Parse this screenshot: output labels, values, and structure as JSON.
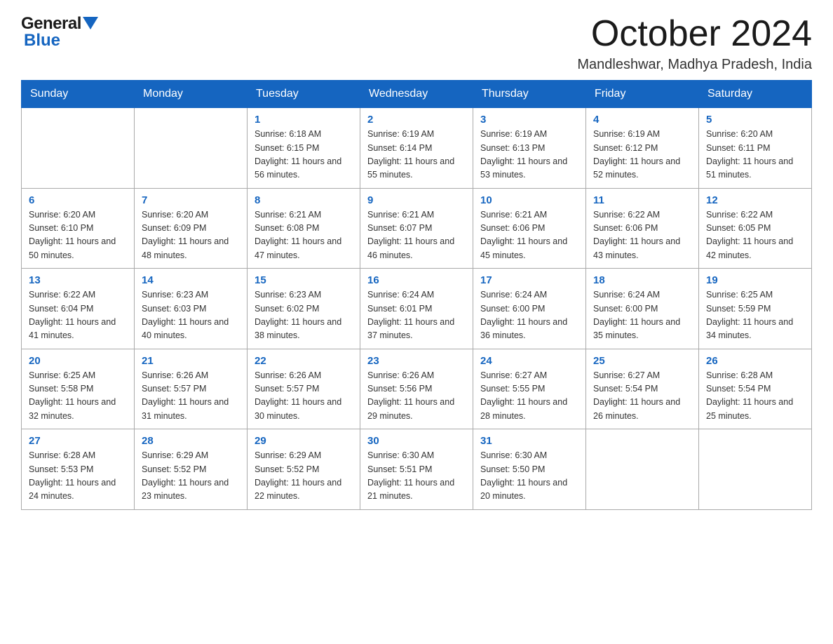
{
  "header": {
    "logo_general": "General",
    "logo_blue": "Blue",
    "month_title": "October 2024",
    "location": "Mandleshwar, Madhya Pradesh, India"
  },
  "days_of_week": [
    "Sunday",
    "Monday",
    "Tuesday",
    "Wednesday",
    "Thursday",
    "Friday",
    "Saturday"
  ],
  "weeks": [
    [
      {
        "day": "",
        "sunrise": "",
        "sunset": "",
        "daylight": ""
      },
      {
        "day": "",
        "sunrise": "",
        "sunset": "",
        "daylight": ""
      },
      {
        "day": "1",
        "sunrise": "Sunrise: 6:18 AM",
        "sunset": "Sunset: 6:15 PM",
        "daylight": "Daylight: 11 hours and 56 minutes."
      },
      {
        "day": "2",
        "sunrise": "Sunrise: 6:19 AM",
        "sunset": "Sunset: 6:14 PM",
        "daylight": "Daylight: 11 hours and 55 minutes."
      },
      {
        "day": "3",
        "sunrise": "Sunrise: 6:19 AM",
        "sunset": "Sunset: 6:13 PM",
        "daylight": "Daylight: 11 hours and 53 minutes."
      },
      {
        "day": "4",
        "sunrise": "Sunrise: 6:19 AM",
        "sunset": "Sunset: 6:12 PM",
        "daylight": "Daylight: 11 hours and 52 minutes."
      },
      {
        "day": "5",
        "sunrise": "Sunrise: 6:20 AM",
        "sunset": "Sunset: 6:11 PM",
        "daylight": "Daylight: 11 hours and 51 minutes."
      }
    ],
    [
      {
        "day": "6",
        "sunrise": "Sunrise: 6:20 AM",
        "sunset": "Sunset: 6:10 PM",
        "daylight": "Daylight: 11 hours and 50 minutes."
      },
      {
        "day": "7",
        "sunrise": "Sunrise: 6:20 AM",
        "sunset": "Sunset: 6:09 PM",
        "daylight": "Daylight: 11 hours and 48 minutes."
      },
      {
        "day": "8",
        "sunrise": "Sunrise: 6:21 AM",
        "sunset": "Sunset: 6:08 PM",
        "daylight": "Daylight: 11 hours and 47 minutes."
      },
      {
        "day": "9",
        "sunrise": "Sunrise: 6:21 AM",
        "sunset": "Sunset: 6:07 PM",
        "daylight": "Daylight: 11 hours and 46 minutes."
      },
      {
        "day": "10",
        "sunrise": "Sunrise: 6:21 AM",
        "sunset": "Sunset: 6:06 PM",
        "daylight": "Daylight: 11 hours and 45 minutes."
      },
      {
        "day": "11",
        "sunrise": "Sunrise: 6:22 AM",
        "sunset": "Sunset: 6:06 PM",
        "daylight": "Daylight: 11 hours and 43 minutes."
      },
      {
        "day": "12",
        "sunrise": "Sunrise: 6:22 AM",
        "sunset": "Sunset: 6:05 PM",
        "daylight": "Daylight: 11 hours and 42 minutes."
      }
    ],
    [
      {
        "day": "13",
        "sunrise": "Sunrise: 6:22 AM",
        "sunset": "Sunset: 6:04 PM",
        "daylight": "Daylight: 11 hours and 41 minutes."
      },
      {
        "day": "14",
        "sunrise": "Sunrise: 6:23 AM",
        "sunset": "Sunset: 6:03 PM",
        "daylight": "Daylight: 11 hours and 40 minutes."
      },
      {
        "day": "15",
        "sunrise": "Sunrise: 6:23 AM",
        "sunset": "Sunset: 6:02 PM",
        "daylight": "Daylight: 11 hours and 38 minutes."
      },
      {
        "day": "16",
        "sunrise": "Sunrise: 6:24 AM",
        "sunset": "Sunset: 6:01 PM",
        "daylight": "Daylight: 11 hours and 37 minutes."
      },
      {
        "day": "17",
        "sunrise": "Sunrise: 6:24 AM",
        "sunset": "Sunset: 6:00 PM",
        "daylight": "Daylight: 11 hours and 36 minutes."
      },
      {
        "day": "18",
        "sunrise": "Sunrise: 6:24 AM",
        "sunset": "Sunset: 6:00 PM",
        "daylight": "Daylight: 11 hours and 35 minutes."
      },
      {
        "day": "19",
        "sunrise": "Sunrise: 6:25 AM",
        "sunset": "Sunset: 5:59 PM",
        "daylight": "Daylight: 11 hours and 34 minutes."
      }
    ],
    [
      {
        "day": "20",
        "sunrise": "Sunrise: 6:25 AM",
        "sunset": "Sunset: 5:58 PM",
        "daylight": "Daylight: 11 hours and 32 minutes."
      },
      {
        "day": "21",
        "sunrise": "Sunrise: 6:26 AM",
        "sunset": "Sunset: 5:57 PM",
        "daylight": "Daylight: 11 hours and 31 minutes."
      },
      {
        "day": "22",
        "sunrise": "Sunrise: 6:26 AM",
        "sunset": "Sunset: 5:57 PM",
        "daylight": "Daylight: 11 hours and 30 minutes."
      },
      {
        "day": "23",
        "sunrise": "Sunrise: 6:26 AM",
        "sunset": "Sunset: 5:56 PM",
        "daylight": "Daylight: 11 hours and 29 minutes."
      },
      {
        "day": "24",
        "sunrise": "Sunrise: 6:27 AM",
        "sunset": "Sunset: 5:55 PM",
        "daylight": "Daylight: 11 hours and 28 minutes."
      },
      {
        "day": "25",
        "sunrise": "Sunrise: 6:27 AM",
        "sunset": "Sunset: 5:54 PM",
        "daylight": "Daylight: 11 hours and 26 minutes."
      },
      {
        "day": "26",
        "sunrise": "Sunrise: 6:28 AM",
        "sunset": "Sunset: 5:54 PM",
        "daylight": "Daylight: 11 hours and 25 minutes."
      }
    ],
    [
      {
        "day": "27",
        "sunrise": "Sunrise: 6:28 AM",
        "sunset": "Sunset: 5:53 PM",
        "daylight": "Daylight: 11 hours and 24 minutes."
      },
      {
        "day": "28",
        "sunrise": "Sunrise: 6:29 AM",
        "sunset": "Sunset: 5:52 PM",
        "daylight": "Daylight: 11 hours and 23 minutes."
      },
      {
        "day": "29",
        "sunrise": "Sunrise: 6:29 AM",
        "sunset": "Sunset: 5:52 PM",
        "daylight": "Daylight: 11 hours and 22 minutes."
      },
      {
        "day": "30",
        "sunrise": "Sunrise: 6:30 AM",
        "sunset": "Sunset: 5:51 PM",
        "daylight": "Daylight: 11 hours and 21 minutes."
      },
      {
        "day": "31",
        "sunrise": "Sunrise: 6:30 AM",
        "sunset": "Sunset: 5:50 PM",
        "daylight": "Daylight: 11 hours and 20 minutes."
      },
      {
        "day": "",
        "sunrise": "",
        "sunset": "",
        "daylight": ""
      },
      {
        "day": "",
        "sunrise": "",
        "sunset": "",
        "daylight": ""
      }
    ]
  ]
}
